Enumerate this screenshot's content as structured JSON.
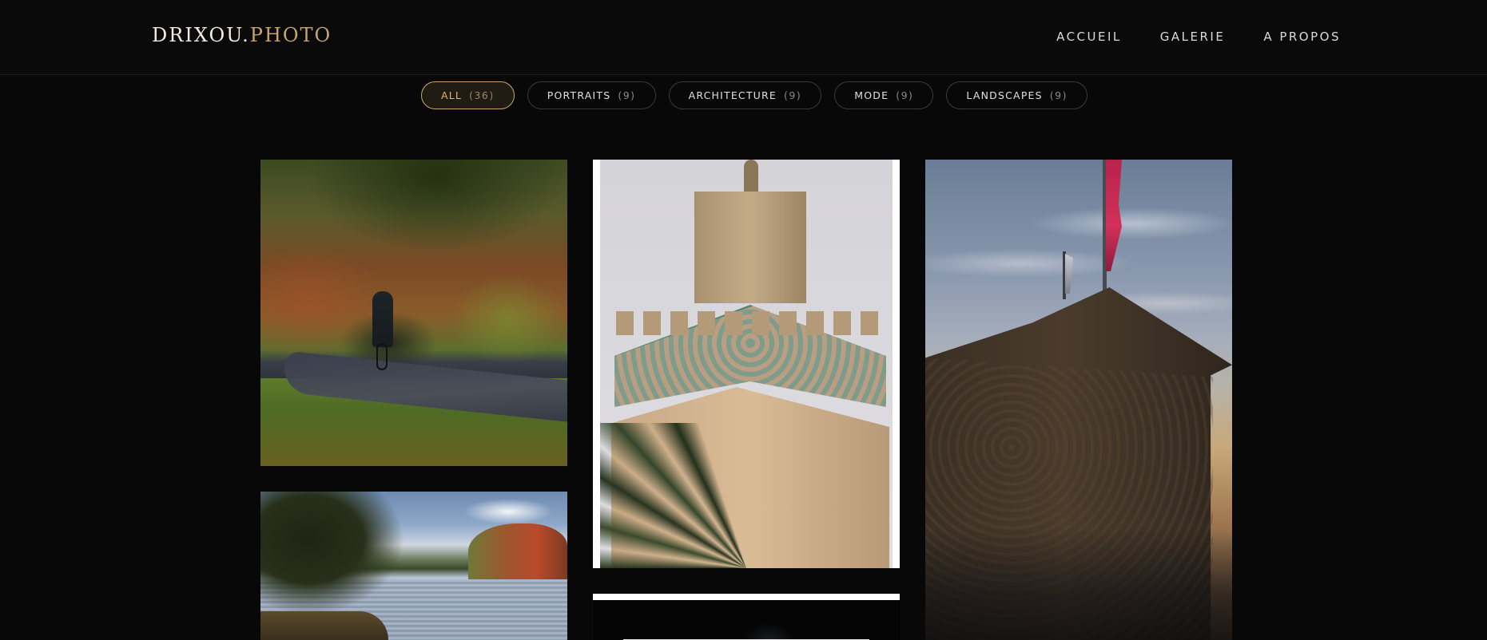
{
  "brand": {
    "name": "DRIXOU.",
    "accent": "PHOTO",
    "accent_color": "#c9a56b"
  },
  "nav": {
    "items": [
      {
        "label": "ACCUEIL"
      },
      {
        "label": "GALERIE"
      },
      {
        "label": "A PROPOS"
      }
    ]
  },
  "filters": {
    "active": "ALL",
    "items": [
      {
        "label": "ALL",
        "count": "(36)"
      },
      {
        "label": "PORTRAITS",
        "count": "(9)"
      },
      {
        "label": "ARCHITECTURE",
        "count": "(9)"
      },
      {
        "label": "MODE",
        "count": "(9)"
      },
      {
        "label": "LANDSCAPES",
        "count": "(9)"
      }
    ]
  },
  "gallery": {
    "photos": [
      {
        "subject": "autumn-bike-path"
      },
      {
        "subject": "minaret-tower"
      },
      {
        "subject": "stone-tower-with-flag"
      },
      {
        "subject": "lake-with-autumn-trees"
      },
      {
        "subject": "dark-night-photo"
      }
    ]
  },
  "colors": {
    "background": "#080808",
    "accent": "#c9a56b",
    "text": "#d9d9d9",
    "muted": "#8a8a8a"
  }
}
